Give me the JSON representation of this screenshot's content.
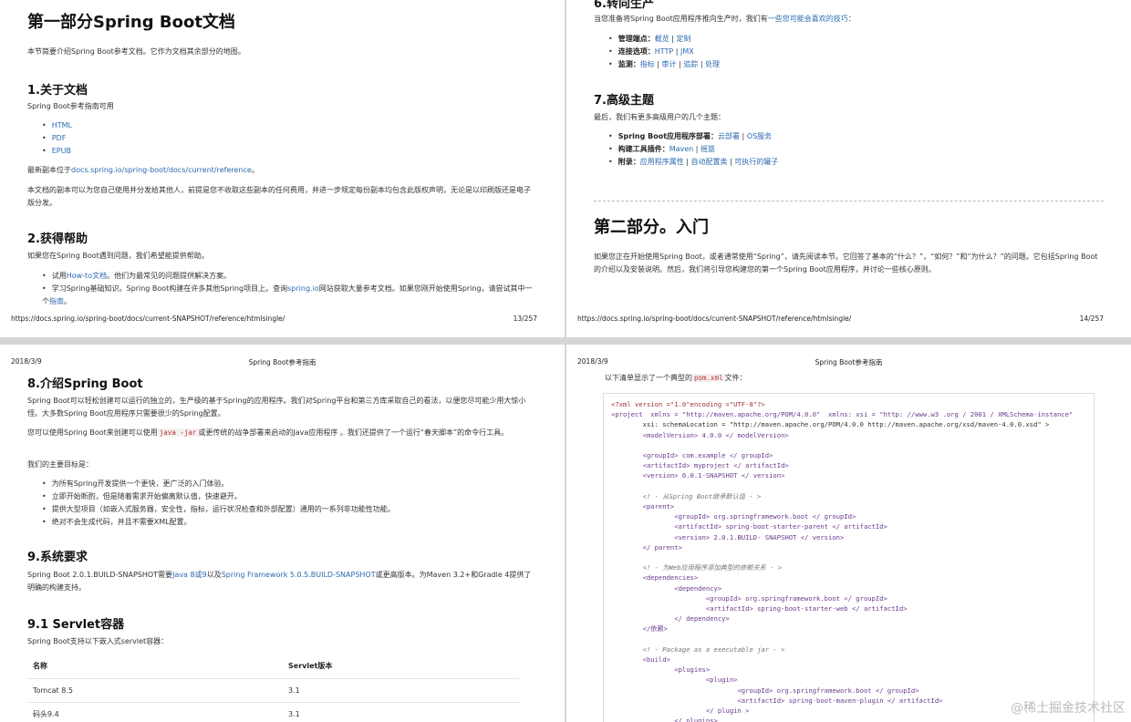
{
  "p1": {
    "title": "第一部分Spring Boot文档",
    "intro": "本节简要介绍Spring Boot参考文档。它作为文档其余部分的地图。",
    "s1_title": "1.关于文档",
    "s1_text": "Spring Boot参考指南可用",
    "s1_items": [
      "HTML",
      "PDF",
      "EPUB"
    ],
    "s1_latest_pre": "最新副本位于",
    "s1_latest_link": "docs.spring.io/spring-boot/docs/current/reference",
    "s1_latest_post": "。",
    "s1_copy": "本文档的副本可以为您自己使用并分发给其他人，前提是您不收取这些副本的任何费用，并进一步规定每份副本均包含此版权声明，无论是以印刷版还是电子版分发。",
    "s2_title": "2.获得帮助",
    "s2_text": "如果您在Spring Boot遇到问题，我们希望能提供帮助。",
    "s2_i1_pre": "试用",
    "s2_i1_link": "How-to文档",
    "s2_i1_post": "。他们为最常见的问题提供解决方案。",
    "s2_i2_pre": "学习Spring基础知识。Spring Boot构建在许多其他Spring项目上。查询",
    "s2_i2_link": "spring.io",
    "s2_i2_post": "网站获取大量参考文档。如果您刚开始使用Spring，请尝试其中一个",
    "s2_i2_link2": "指南",
    "s2_i2_end": "。",
    "footer_url": "https://docs.spring.io/spring-boot/docs/current-SNAPSHOT/reference/htmlsingle/",
    "footer_page": "13/257"
  },
  "p2": {
    "top_title": "6.转向生产",
    "intro_pre": "当您准备将Spring Boot应用程序推向生产时，我们有",
    "intro_link": "一些您可能会喜欢的技巧",
    "intro_post": "：",
    "items": [
      {
        "label": "管理端点：",
        "links": [
          "概览",
          "定制"
        ]
      },
      {
        "label": "连接选项：",
        "links": [
          "HTTP",
          "JMX"
        ]
      },
      {
        "label": "监测：",
        "links": [
          "指标",
          "审计",
          "追踪",
          "处理"
        ]
      }
    ],
    "s7_title": "7.高级主题",
    "s7_text": "最后，我们有更多高级用户的几个主题：",
    "s7_items": [
      {
        "label": "Spring Boot应用程序部署：",
        "links": [
          "云部署",
          "OS服务"
        ]
      },
      {
        "label": "构建工具插件：",
        "links": [
          "Maven",
          "摇篮"
        ]
      },
      {
        "label": "附录：",
        "links": [
          "应用程序属性",
          "自动配置类",
          "可执行的罐子"
        ]
      }
    ],
    "part2_title": "第二部分。入门",
    "part2_text": "如果您正在开始使用Spring Boot，或者通常使用“Spring”，请先阅读本节。它回答了基本的“什么？”，“如何？”和“为什么？”的问题。它包括Spring Boot的介绍以及安装说明。然后，我们将引导您构建您的第一个Spring Boot应用程序，并讨论一些核心原则。",
    "footer_url": "https://docs.spring.io/spring-boot/docs/current-SNAPSHOT/reference/htmlsingle/",
    "footer_page": "14/257"
  },
  "p3": {
    "date": "2018/3/9",
    "header": "Spring Boot参考指南",
    "s8_title": "8.介绍Spring Boot",
    "s8_p1": "Spring Boot可以轻松创建可以运行的独立的，生产级的基于Spring的应用程序。我们对Spring平台和第三方库采取自己的看法，以便您尽可能少用大惊小怪。大多数Spring Boot应用程序只需要很少的Spring配置。",
    "s8_p2_pre": "您可以使用Spring Boot来创建可以使用",
    "s8_p2_code": "java -jar",
    "s8_p2_post": "或更传统的战争部署来启动的Java应用程序 。我们还提供了一个运行“春天脚本”的命令行工具。",
    "s8_p3": "我们的主要目标是：",
    "s8_goals": [
      "为所有Spring开发提供一个更快，更广泛的入门体验。",
      "立即开始断酌，但是随着需求开始偏离默认值，快速避开。",
      "提供大型项目（如嵌入式服务器，安全性，指标，运行状况检查和外部配置）通用的一系列非功能性功能。",
      "绝对不会生成代码，并且不需要XML配置。"
    ],
    "s9_title": "9.系统要求",
    "s9_pre": "Spring Boot 2.0.1.BUILD-SNAPSHOT需要",
    "s9_link1": "Java 8或9",
    "s9_mid": "以及",
    "s9_link2": "Spring Framework 5.0.5.BUILD-SNAPSHOT",
    "s9_post": "或更高版本。为Maven 3.2+和Gradle 4提供了明确的构建支持。",
    "s91_title": "9.1 Servlet容器",
    "s91_text": "Spring Boot支持以下嵌入式servlet容器：",
    "table_headers": [
      "名称",
      "Servlet版本"
    ],
    "table_rows": [
      [
        "Tomcat 8.5",
        "3.1"
      ],
      [
        "码头9.4",
        "3.1"
      ]
    ]
  },
  "p4": {
    "date": "2018/3/9",
    "header": "Spring Boot参考指南",
    "intro_pre": "以下清单显示了一个典型的",
    "intro_code": "pom.xml",
    "intro_post": "文件：",
    "watermark": "@稀土掘金技术社区",
    "code_lines": [
      "<?xml version =\"1.0\"encoding =\"UTF-8\"?>",
      "<project  xmlns = \"http://maven.apache.org/POM/4.0.0\"  xmlns: xsi = \"http: //www.w3 .org / 2001 / XMLSchema-instance\"",
      "        xsi: schemaLocation = \"http://maven.apache.org/POM/4.0.0 http://maven.apache.org/xsd/maven-4.0.0.xsd\" >",
      "        <modelVersion> 4.0.0 </ modelVersion>",
      "",
      "        <groupId> com.example </ groupId>",
      "        <artifactId> myproject </ artifactId>",
      "        <version> 0.0.1-SNAPSHOT </ version>",
      "",
      "        <! - 从Spring Boot继承默认值 - >",
      "        <parent>",
      "                <groupId> org.springframework.boot </ groupId>",
      "                <artifactId> spring-boot-starter-parent </ artifactId>",
      "                <version> 2.0.1.BUILD- SNAPSHOT </ version>",
      "        </ parent>",
      "",
      "        <! - 为Web应用程序添加典型的依赖关系 - >",
      "        <dependencies>",
      "                <dependency>",
      "                        <groupId> org.springframework.boot </ groupId>",
      "                        <artifactId> spring-boot-starter-web </ artifactId>",
      "                </ dependency>",
      "        </依赖>",
      "",
      "        <! - Package as a executable jar - >",
      "        <build>",
      "                <plugins>",
      "                        <plugin>",
      "                                <groupId> org.springframework.boot </ groupId>",
      "                                <artifactId> spring-boot-maven-plugin </ artifactId>",
      "                        </ plugin >",
      "                </ plugins>"
    ]
  }
}
